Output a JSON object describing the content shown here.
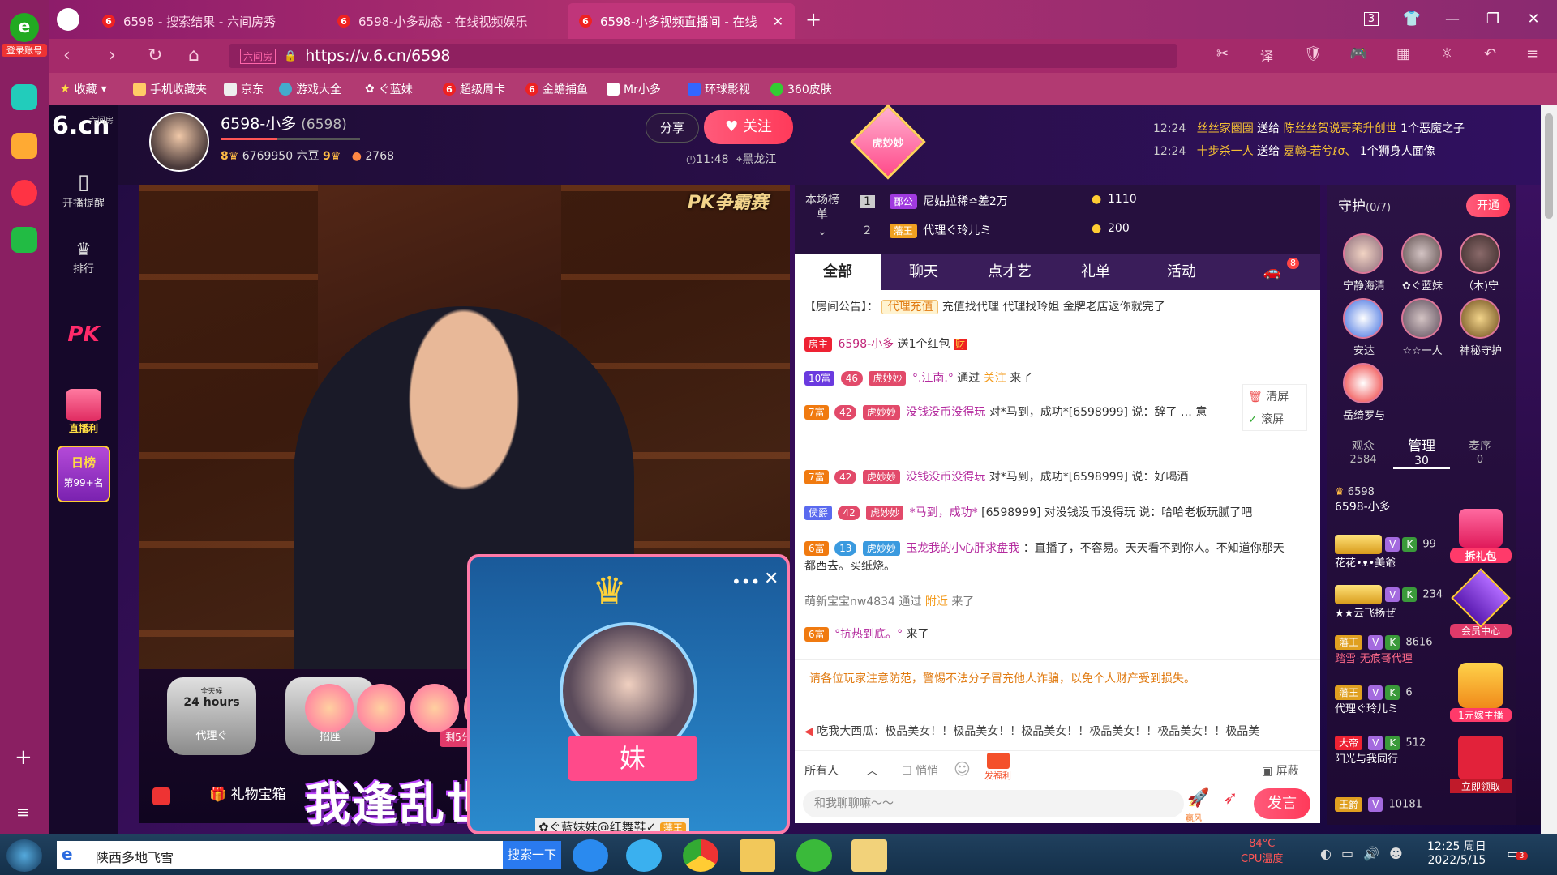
{
  "browser": {
    "tabs": [
      {
        "label": "6598 - 搜索结果 - 六间房秀"
      },
      {
        "label": "6598-小多动态 - 在线视频娱乐"
      },
      {
        "label": "6598-小多视频直播间 - 在线"
      }
    ],
    "tab_count": "3",
    "url": "https://v.6.cn/6598",
    "url_tag": "六间房",
    "side_label": "登录账号",
    "bookmarks": [
      "收藏",
      "手机收藏夹",
      "京东",
      "游戏大全",
      "ぐ蓝妹",
      "超级周卡",
      "金蟾捕鱼",
      "Mr小多",
      "环球影视",
      "360皮肤"
    ]
  },
  "site_nav": {
    "logo": "6.cn",
    "logo_sub": "六间房",
    "items": [
      "开播提醒",
      "排行",
      "PK",
      "直播利"
    ],
    "day_rank": "日榜",
    "day_rank_pos": "第99+名"
  },
  "header": {
    "anchor_name": "6598-小多",
    "room_id": "(6598)",
    "level_left": "8",
    "beans": "6769950 六豆",
    "level_right": "9",
    "fans": "2768",
    "share": "分享",
    "follow": "关注",
    "time": "11:48",
    "location": "黑龙江",
    "badge": "虎妙妙",
    "notices": [
      {
        "time": "12:24",
        "from": "丝丝家圈圈",
        "action": "送给",
        "to": "陈丝丝贺说哥荣升创世",
        "gift": "1个恶魔之子"
      },
      {
        "time": "12:24",
        "from": "十步杀一人",
        "action": "送给",
        "to": "嘉翰-若兮ℓσ、",
        "gift": "1个狮身人面像"
      }
    ]
  },
  "video": {
    "pk_tag": "PK争霸赛",
    "seats": [
      {
        "top": "全天候",
        "mid": "24 hours",
        "name": "代理ぐ"
      },
      {
        "name": "招座"
      }
    ],
    "slogan": "我逢乱世  踏马出征",
    "gift_box": "礼物宝箱",
    "countdown": "剩5分",
    "popup_user": "✿ぐ蓝妹妹@红舞鞋✓",
    "popup_badge": "藩王",
    "popup_title": "妹"
  },
  "rank": {
    "label": "本场榜单",
    "rows": [
      {
        "pos": "1",
        "title": "郡公",
        "name": "尼姑拉稀≏差2万",
        "coins": "1110"
      },
      {
        "pos": "2",
        "title": "藩王",
        "name": "代理ぐ玲儿ミ",
        "coins": "200"
      }
    ]
  },
  "chat": {
    "tabs": [
      "全部",
      "聊天",
      "点才艺",
      "礼单",
      "活动"
    ],
    "car_badge": "8",
    "notice_label": "【房间公告】：",
    "notice_tag": "代理充值",
    "notice_text": "充值找代理 代理找玲姐 金牌老店返你就完了",
    "clear_btn": "清屏",
    "scroll_btn": "滚屏",
    "messages": [
      {
        "badge": "房主",
        "name": "6598-小多",
        "text": "送1个红包"
      },
      {
        "badge": "10富",
        "lv": "46",
        "lvname": "虎妙妙",
        "name": "°.江南.°",
        "text": "通过",
        "hl": "关注",
        "tail": "来了"
      },
      {
        "badge": "7富",
        "lv": "42",
        "lvname": "虎妙妙",
        "name": "没钱没币没得玩",
        "text": "对*马到，成功*[6598999] 说：辞了 … 意"
      },
      {
        "badge": "7富",
        "lv": "42",
        "lvname": "虎妙妙",
        "name": "没钱没币没得玩",
        "text": "对*马到，成功*[6598999] 说：好喝酒"
      },
      {
        "badge": "侯爵",
        "lv": "42",
        "lvname": "虎妙妙",
        "name": "*马到，成功*",
        "text": "[6598999] 对没钱没币没得玩 说：哈哈老板玩腻了吧"
      },
      {
        "badge": "6富",
        "lv": "13",
        "lvname": "虎妙妙",
        "name": "玉龙我的小心肝求盘我",
        "text": "：直播了，不容易。天天看不到你人。不知道你那天都西去。买纸烧。"
      },
      {
        "plain": "萌新宝宝nw4834 通过",
        "hl": "附近",
        "tail": "来了"
      },
      {
        "badge": "6富",
        "name": "°抗热到底。°",
        "text": "来了"
      }
    ],
    "warning": "请各位玩家注意防范，警惕不法分子冒充他人诈骗，以免个人财产受到损失。",
    "marquee": "吃我大西瓜：极品美女！！极品美女！！极品美女！！极品美女！！极品美女！！极品美",
    "target": "所有人",
    "quiet": "悄悄",
    "welfare": "发福利",
    "shield": "屏蔽",
    "input_placeholder": "和我聊聊嘛～～",
    "send": "发言",
    "rocket": "嬴风"
  },
  "guard": {
    "title": "守护",
    "count": "(0/7)",
    "open": "开通",
    "members": [
      "宁静海清",
      "✿ぐ蓝妹",
      "（木)守",
      "安达",
      "☆☆一人",
      "神秘守护",
      "岳绮罗与"
    ],
    "audience_label": "观众",
    "audience": "2584",
    "admin_label": "管理",
    "admin": "30",
    "mic_label": "麦序",
    "mic": "0",
    "list": [
      {
        "name": "6598-小多",
        "val": "6598"
      },
      {
        "name": "花花•ᴥ•美爺",
        "val": "99"
      },
      {
        "name": "★★云飞扬ぜ",
        "val": "234"
      },
      {
        "name": "踏雪-无痕哥代理",
        "val": "8616",
        "tag": "藩王"
      },
      {
        "name": "代理ぐ玲儿ミ",
        "val": "6",
        "tag": "藩王"
      },
      {
        "name": "阳光与我同行",
        "val": "512",
        "tag": "大帝"
      },
      {
        "name": "",
        "val": "10181",
        "tag": "王爵"
      }
    ],
    "gift_pack": "拆礼包",
    "member_center": "会员中心",
    "one_yuan": "1元嫁主播",
    "receive": "立即领取"
  },
  "taskbar": {
    "search_text": "陕西多地飞雪",
    "search_btn": "搜索一下",
    "temp": "84°C",
    "temp_label": "CPU温度",
    "time": "12:25 周日",
    "date": "2022/5/15",
    "notif": "3"
  }
}
